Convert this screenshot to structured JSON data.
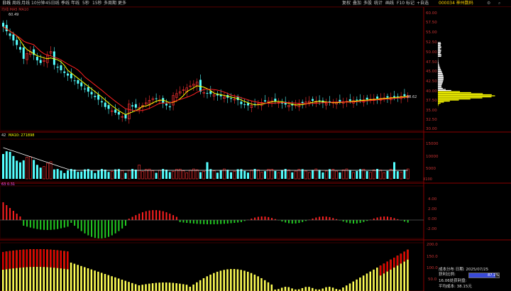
{
  "toolbar": {
    "periods": [
      "日线",
      "周线",
      "月线",
      "10分钟",
      "45日线",
      "季线",
      "年线",
      "5秒",
      "15秒",
      "多周期",
      "更多"
    ],
    "right_items": [
      "复权",
      "叠加",
      "多股",
      "统计",
      "画线",
      "F10",
      "标记",
      "+自选"
    ],
    "stock_code": "000034 神州数码"
  },
  "main_panel": {
    "ma_label": "均线:MA5 MA10",
    "peak_label": "60.49",
    "last_label": "38.62",
    "yticks": [
      "60.00",
      "57.50",
      "55.00",
      "52.50",
      "50.00",
      "47.50",
      "45.00",
      "42.50",
      "40.00",
      "37.50",
      "35.00",
      "32.50",
      "30.00"
    ]
  },
  "volume_panel": {
    "label_a": "42",
    "label_b": "MA10: 271898",
    "yticks": [
      "15000",
      "10000",
      "5000"
    ],
    "unit": "X100"
  },
  "macd_panel": {
    "label": "63  0.31",
    "yticks": [
      "4.00",
      "2.00",
      "0.00",
      "-2.00"
    ]
  },
  "cost_panel": {
    "yticks": [
      "200.0",
      "150.0",
      "100.0",
      "50.0"
    ]
  },
  "chip_info": {
    "dist_label": "成本分布",
    "date_label": "日期: 2025/07/25",
    "profit_label": "获利比例:",
    "profit_value": "87.1%",
    "profit_fraction": 0.871,
    "line3": "16.06处获利盘:",
    "line4": "平均成本: 38.15元"
  },
  "colors": {
    "up": "#ff3232",
    "down": "#54ffff",
    "ma5": "#ffff00",
    "ma10": "#ff2020",
    "grid": "#3a0000",
    "macd_up": "#ff2020",
    "macd_down": "#22cc22",
    "cost_yellow": "#ffff55",
    "cost_red": "#dd0000"
  }
}
